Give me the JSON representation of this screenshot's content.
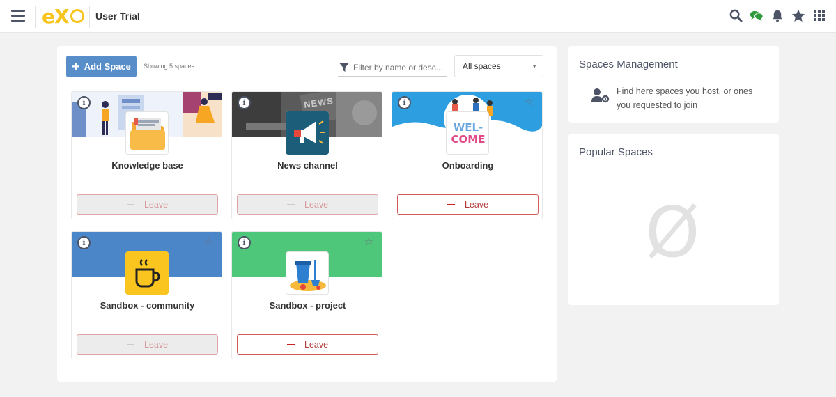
{
  "app": {
    "title": "User Trial",
    "logo_text": "eX",
    "colors": {
      "accent": "#578dc9",
      "logo": "#f7c51e",
      "leave": "#c22"
    }
  },
  "header_icons": [
    "search-icon",
    "chat-icon",
    "bell-icon",
    "star-icon",
    "app-grid-icon"
  ],
  "toolbar": {
    "add_label": "Add Space",
    "showing": "Showing 5 spaces",
    "filter_placeholder": "Filter by name or desc...",
    "select_value": "All spaces"
  },
  "spaces": [
    {
      "name": "Knowledge base",
      "leave_label": "Leave",
      "leave_enabled": false,
      "banner_color": "#eef3fb",
      "has_star": false
    },
    {
      "name": "News channel",
      "leave_label": "Leave",
      "leave_enabled": false,
      "banner_color": "#555555",
      "has_star": false
    },
    {
      "name": "Onboarding",
      "leave_label": "Leave",
      "leave_enabled": true,
      "banner_color": "#2d9ee0",
      "has_star": true
    },
    {
      "name": "Sandbox - community",
      "leave_label": "Leave",
      "leave_enabled": false,
      "banner_color": "#4a86c8",
      "has_star": true
    },
    {
      "name": "Sandbox - project",
      "leave_label": "Leave",
      "leave_enabled": true,
      "banner_color": "#4ec77a",
      "has_star": true
    }
  ],
  "onboarding_avatar": {
    "line1": "WEL-",
    "line2": "COME"
  },
  "news_banner_text": "NEWS",
  "management": {
    "title": "Spaces Management",
    "text": "Find here spaces you host, or ones you requested to join"
  },
  "popular": {
    "title": "Popular Spaces",
    "empty_symbol": "Ø"
  }
}
